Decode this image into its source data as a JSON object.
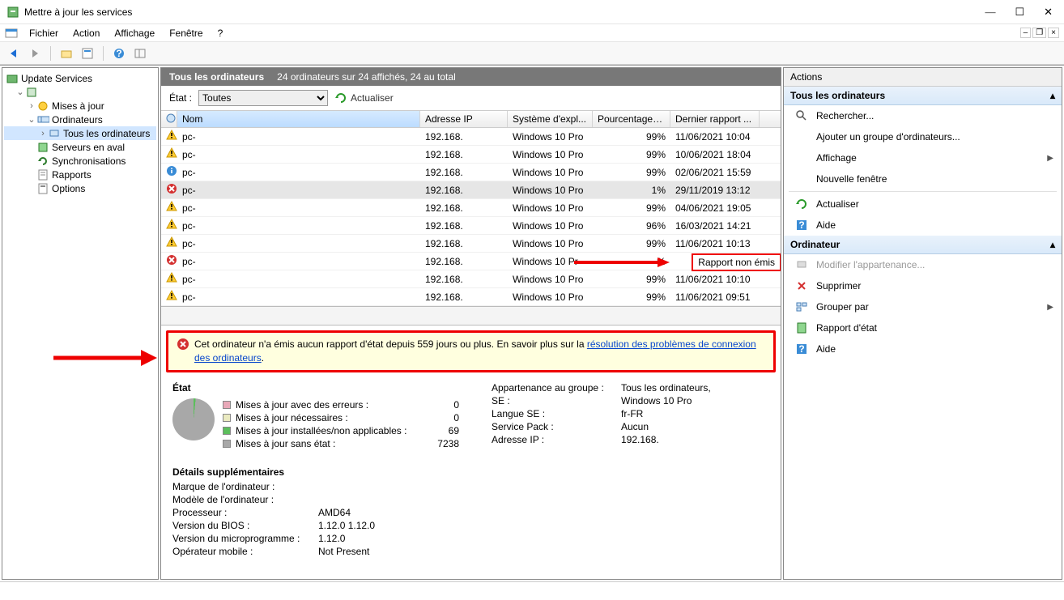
{
  "window": {
    "title": "Mettre à jour les services"
  },
  "menu": {
    "file": "Fichier",
    "action": "Action",
    "view": "Affichage",
    "window": "Fenêtre",
    "help": "?"
  },
  "tree": {
    "root": "Update Services",
    "server": " ",
    "updates": "Mises à jour",
    "computers": "Ordinateurs",
    "allcomputers": "Tous les ordinateurs",
    "downstream": "Serveurs en aval",
    "sync": "Synchronisations",
    "reports": "Rapports",
    "options": "Options"
  },
  "header": {
    "title": "Tous les ordinateurs",
    "summary": "24 ordinateurs sur 24 affichés, 24 au total"
  },
  "filter": {
    "label": "État :",
    "value": "Toutes",
    "refresh": "Actualiser"
  },
  "cols": {
    "name": "Nom",
    "ip": "Adresse IP",
    "os": "Système d'expl...",
    "pct": "Pourcentage i...",
    "date": "Dernier rapport ..."
  },
  "rows": [
    {
      "st": "warn",
      "name": "pc-",
      "ip": "192.168.",
      "os": "Windows 10 Pro",
      "pct": "99%",
      "date": "11/06/2021 10:04"
    },
    {
      "st": "warn",
      "name": "pc-",
      "ip": "192.168.",
      "os": "Windows 10 Pro",
      "pct": "99%",
      "date": "10/06/2021 18:04"
    },
    {
      "st": "info",
      "name": "pc-",
      "ip": "192.168.",
      "os": "Windows 10 Pro",
      "pct": "99%",
      "date": "02/06/2021 15:59"
    },
    {
      "st": "error",
      "name": "pc-",
      "ip": "192.168.",
      "os": "Windows 10 Pro",
      "pct": "1%",
      "date": "29/11/2019 13:12",
      "sel": true
    },
    {
      "st": "warn",
      "name": "pc-",
      "ip": "192.168.",
      "os": "Windows 10 Pro",
      "pct": "99%",
      "date": "04/06/2021 19:05"
    },
    {
      "st": "warn",
      "name": "pc-",
      "ip": "192.168.",
      "os": "Windows 10 Pro",
      "pct": "96%",
      "date": "16/03/2021 14:21"
    },
    {
      "st": "warn",
      "name": "pc-",
      "ip": "192.168.",
      "os": "Windows 10 Pro",
      "pct": "99%",
      "date": "11/06/2021 10:13"
    },
    {
      "st": "error",
      "name": "pc-",
      "ip": "192.168.",
      "os": "Windows 10 Pr",
      "pct": "%",
      "date": "",
      "callout": true
    },
    {
      "st": "warn",
      "name": "pc-",
      "ip": "192.168.",
      "os": "Windows 10 Pro",
      "pct": "99%",
      "date": "11/06/2021 10:10"
    },
    {
      "st": "warn",
      "name": "pc-",
      "ip": "192.168.",
      "os": "Windows 10 Pro",
      "pct": "99%",
      "date": "11/06/2021 09:51"
    }
  ],
  "callout": "Rapport non émis",
  "warning": {
    "text1": "Cet ordinateur n'a émis aucun rapport d'état depuis 559 jours ou plus. En savoir plus sur la ",
    "link": "résolution des problèmes de connexion des ordinateurs",
    "text2": "."
  },
  "etat": {
    "title": "État",
    "l1": "Mises à jour avec des erreurs :",
    "v1": "0",
    "l2": "Mises à jour nécessaires :",
    "v2": "0",
    "l3": "Mises à jour installées/non applicables :",
    "v3": "69",
    "l4": "Mises à jour sans état :",
    "v4": "7238"
  },
  "info": {
    "k1": "Appartenance au groupe :",
    "v1": "Tous les ordinateurs,",
    "k2": "SE :",
    "v2": "Windows 10 Pro",
    "k3": "Langue SE :",
    "v3": "fr-FR",
    "k4": "Service Pack :",
    "v4": "Aucun",
    "k5": "Adresse IP :",
    "v5": "192.168."
  },
  "extra": {
    "title": "Détails supplémentaires",
    "k1": "Marque de l'ordinateur :",
    "v1": "",
    "k2": "Modèle de l'ordinateur :",
    "v2": "",
    "k3": "Processeur :",
    "v3": "AMD64",
    "k4": "Version du BIOS :",
    "v4": "1.12.0 1.12.0",
    "k5": "Version du microprogramme :",
    "v5": "1.12.0",
    "k6": "Opérateur mobile :",
    "v6": "Not Present"
  },
  "actions": {
    "title": "Actions",
    "s1": "Tous les ordinateurs",
    "a1": "Rechercher...",
    "a2": "Ajouter un groupe d'ordinateurs...",
    "a3": "Affichage",
    "a4": "Nouvelle fenêtre",
    "a5": "Actualiser",
    "a6": "Aide",
    "s2": "Ordinateur",
    "b1": "Modifier l'appartenance...",
    "b2": "Supprimer",
    "b3": "Grouper par",
    "b4": "Rapport d'état",
    "b5": "Aide"
  }
}
